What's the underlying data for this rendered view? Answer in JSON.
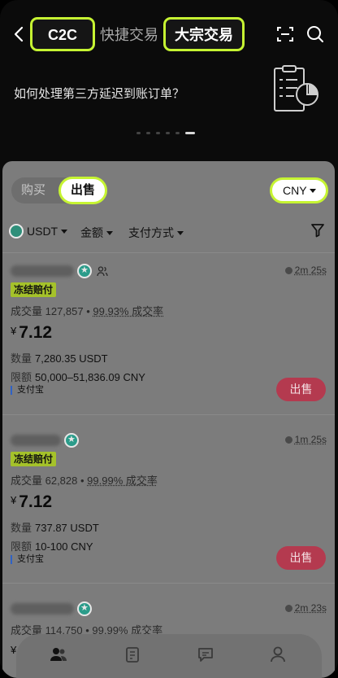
{
  "header": {
    "tabs": [
      {
        "label": "C2C",
        "highlighted": true
      },
      {
        "label": "快捷交易",
        "highlighted": false
      },
      {
        "label": "大宗交易",
        "highlighted": true
      }
    ],
    "icons": [
      "back-icon",
      "scan-icon",
      "search-icon"
    ]
  },
  "banner": {
    "text": "如何处理第三方延迟到账订单？",
    "page_count": 6,
    "active_page": 6
  },
  "trade": {
    "buy_label": "购买",
    "sell_label": "出售",
    "currency": "CNY",
    "filters": {
      "coin": "USDT",
      "amount": "金额",
      "payment": "支付方式"
    }
  },
  "listings": [
    {
      "time": "2m 25s",
      "tag": "冻结赔付",
      "volume": "成交量 127,857",
      "rate": "99.93% 成交率",
      "currency_symbol": "¥",
      "price": "7.12",
      "qty_label": "数量",
      "qty": "7,280.35 USDT",
      "limit_label": "限额",
      "limit": "50,000–51,836.09 CNY",
      "payment": "支付宝",
      "action": "出售"
    },
    {
      "time": "1m 25s",
      "tag": "冻结赔付",
      "volume": "成交量 62,828",
      "rate": "99.99% 成交率",
      "currency_symbol": "¥",
      "price": "7.12",
      "qty_label": "数量",
      "qty": "737.87 USDT",
      "limit_label": "限额",
      "limit": "10-100 CNY",
      "payment": "支付宝",
      "action": "出售"
    },
    {
      "time": "2m 23s",
      "volume": "成交量 114,750",
      "rate": "99.99% 成交率",
      "currency_symbol": "¥"
    }
  ],
  "colors": {
    "highlight": "#c6f432",
    "sell_button": "#b43a4f",
    "tag_bg": "#a5c22a"
  }
}
